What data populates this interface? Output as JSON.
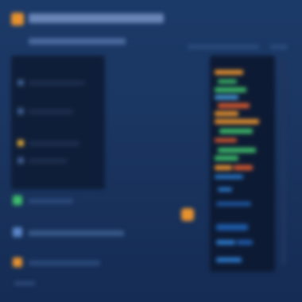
{
  "window": {
    "title": ""
  },
  "header": {
    "title": "",
    "subtitle": ""
  },
  "left_list": {
    "items": [
      {
        "label": "",
        "icon": "document-icon",
        "color": "#3a5a8a"
      },
      {
        "label": "",
        "icon": "document-icon",
        "color": "#3a5a8a"
      },
      {
        "label": "",
        "icon": "folder-icon",
        "color": "#d9a437"
      },
      {
        "label": "",
        "icon": "document-icon",
        "color": "#3a5a8a"
      }
    ]
  },
  "bottom_list": {
    "items": [
      {
        "label": "",
        "icon": "check-icon",
        "color": "#3fbf6a"
      },
      {
        "label": "",
        "icon": "gear-icon",
        "color": "#5a86c8"
      },
      {
        "label": "",
        "icon": "warning-icon",
        "color": "#e8922e"
      }
    ]
  },
  "right_panel": {
    "header": "",
    "accent_colors": [
      "#e8922e",
      "#3fbf6a",
      "#d95a2e",
      "#2a78c8"
    ]
  },
  "colors": {
    "background": "#1a3560",
    "accent_orange": "#e8922e",
    "accent_green": "#3fbf6a",
    "accent_blue": "#2a78c8"
  }
}
